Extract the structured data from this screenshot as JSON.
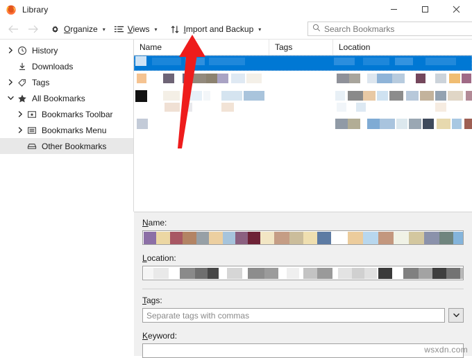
{
  "window": {
    "title": "Library",
    "app_icon": "firefox-logo-icon",
    "controls": {
      "minimize": "minimize-icon",
      "maximize": "maximize-icon",
      "close": "close-icon"
    }
  },
  "toolbar": {
    "back": "back-arrow-icon",
    "forward": "forward-arrow-icon",
    "organize_label": "Organize",
    "organize_icon": "gear-icon",
    "views_label": "Views",
    "views_icon": "list-view-icon",
    "import_label": "Import and Backup",
    "import_icon": "up-down-arrows-icon",
    "caret": "˅"
  },
  "search": {
    "icon": "search-icon",
    "placeholder": "Search Bookmarks",
    "value": ""
  },
  "sidebar": {
    "items": [
      {
        "label": "History",
        "icon": "clock-icon",
        "twisty": "collapsed",
        "level": 1,
        "selected": false
      },
      {
        "label": "Downloads",
        "icon": "download-icon",
        "twisty": "none",
        "level": 1,
        "selected": false
      },
      {
        "label": "Tags",
        "icon": "tag-icon",
        "twisty": "collapsed",
        "level": 1,
        "selected": false
      },
      {
        "label": "All Bookmarks",
        "icon": "star-icon",
        "twisty": "expanded",
        "level": 1,
        "selected": false
      },
      {
        "label": "Bookmarks Toolbar",
        "icon": "toolbar-folder-icon",
        "twisty": "collapsed",
        "level": 2,
        "selected": false
      },
      {
        "label": "Bookmarks Menu",
        "icon": "menu-folder-icon",
        "twisty": "collapsed",
        "level": 2,
        "selected": false
      },
      {
        "label": "Other Bookmarks",
        "icon": "other-folder-icon",
        "twisty": "none",
        "level": 2,
        "selected": true
      }
    ]
  },
  "list": {
    "columns": [
      {
        "label": "Name"
      },
      {
        "label": "Tags"
      },
      {
        "label": "Location"
      }
    ],
    "rows": [
      {
        "selected": true,
        "redacted": true
      },
      {
        "selected": false,
        "redacted": true
      },
      {
        "selected": false,
        "redacted": true
      },
      {
        "selected": false,
        "redacted": true
      }
    ]
  },
  "detail": {
    "name_label": "Name:",
    "name_value": "",
    "location_label": "Location:",
    "location_value": "",
    "tags_label": "Tags:",
    "tags_placeholder": "Separate tags with commas",
    "tags_value": "",
    "tags_dropdown_icon": "chevron-down-icon",
    "keyword_label": "Keyword:",
    "keyword_value": ""
  },
  "annotation": {
    "arrow_color": "#ee1c1c",
    "points_to": "Import and Backup"
  },
  "watermark": {
    "text": "wsxdn.com"
  },
  "colors": {
    "selection_blue": "#0078d4",
    "panel_gray": "#f0f0f0",
    "sidebar_selection": "#e8e8e8"
  }
}
